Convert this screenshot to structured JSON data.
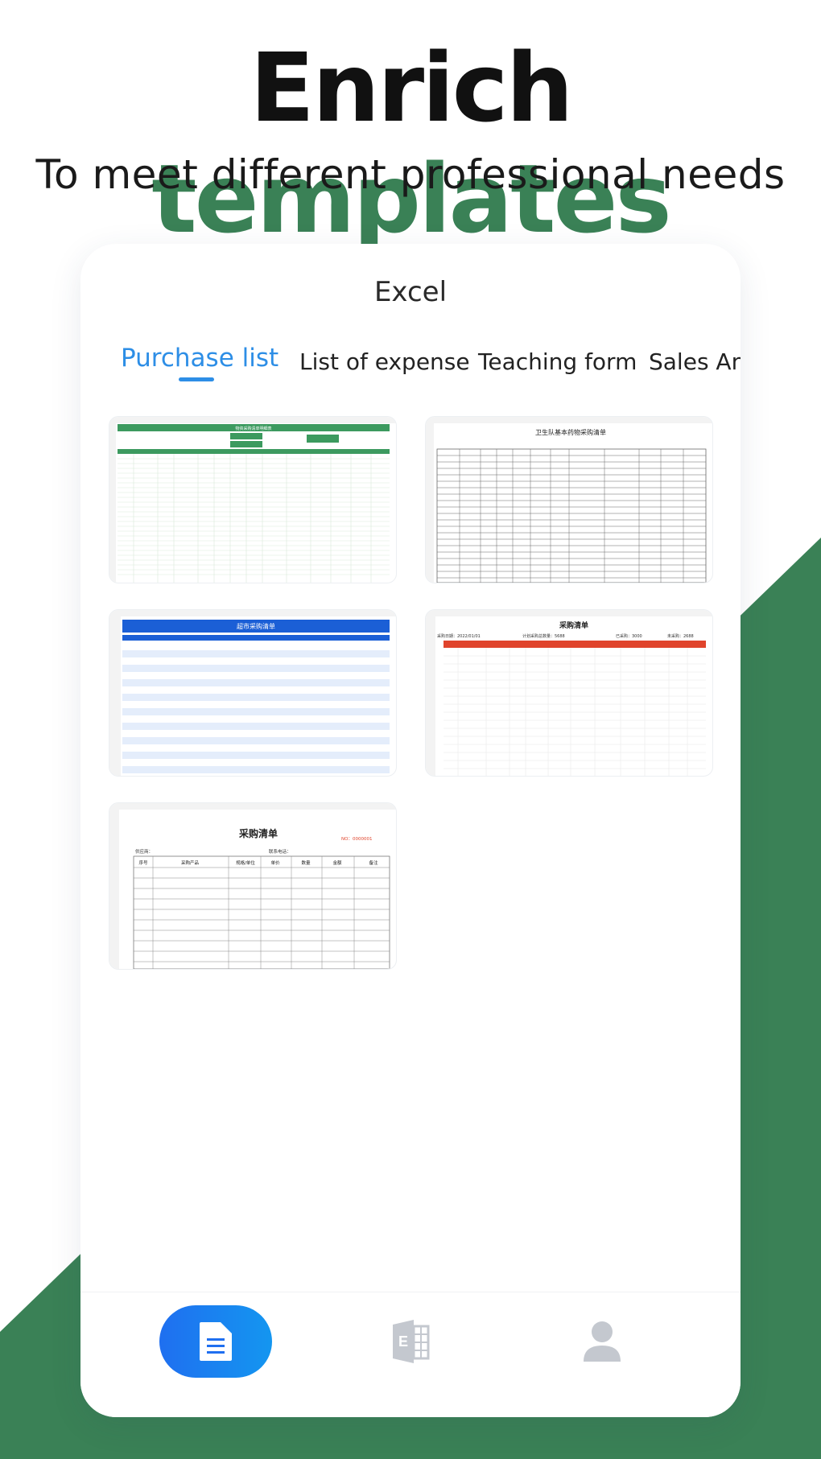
{
  "headline": {
    "word1": "Enrich",
    "word2": "templates"
  },
  "subheadline": "To meet different professional needs",
  "app": {
    "title": "Excel",
    "tabs": [
      {
        "label": "Purchase list",
        "active": true
      },
      {
        "label": "List of expense",
        "active": false
      },
      {
        "label": "Teaching form",
        "active": false
      },
      {
        "label": "Sales Ana",
        "active": false
      }
    ],
    "templates": [
      {
        "title": "物资采购清单明细表",
        "accent": "#3c9a5f"
      },
      {
        "title": "卫生队基本药物采购清单",
        "accent": "#555555"
      },
      {
        "title": "超市采购清单",
        "accent": "#1b5fd6"
      },
      {
        "title": "采购清单",
        "accent": "#e0442c",
        "info": [
          "采购日期：2022/01/01",
          "计划采购总数量：5688",
          "已采购：3000",
          "未采购：2688"
        ]
      },
      {
        "title": "采购清单",
        "accent": "#333333",
        "no": "NO：0000001",
        "supplier": "供应商：",
        "phone": "联系电话：",
        "columns": [
          "序号",
          "采购产品",
          "规格/单位",
          "单价",
          "数量",
          "金额",
          "备注"
        ]
      }
    ],
    "nav": [
      {
        "name": "docs",
        "icon": "document-icon",
        "active": true
      },
      {
        "name": "excel",
        "icon": "excel-icon",
        "active": false
      },
      {
        "name": "profile",
        "icon": "user-icon",
        "active": false
      }
    ]
  },
  "colors": {
    "brand_green": "#3a8156",
    "accent_blue": "#2d8ee6",
    "nav_blue": "#1f6ff0"
  }
}
